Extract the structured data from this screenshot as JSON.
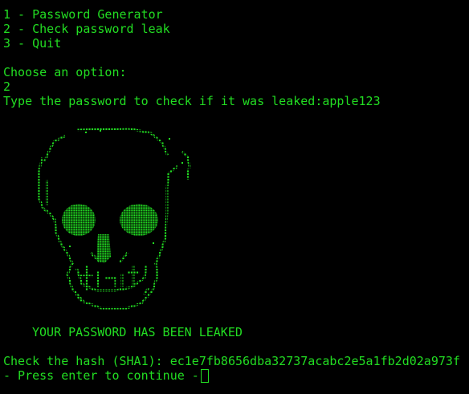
{
  "menu": {
    "items": [
      "1 - Password Generator",
      "2 - Check password leak",
      "3 - Quit"
    ]
  },
  "prompt": {
    "choose": "Choose an option:",
    "choice": "2",
    "check_prompt": "Type the password to check if it was leaked:apple123"
  },
  "skull": {
    "icon": "skull-icon",
    "color": "#22dd22"
  },
  "result": {
    "leaked_message": "YOUR PASSWORD HAS BEEN LEAKED",
    "hash_line": "Check the hash (SHA1): ec1e7fb8656dba32737acabc2e5a1fb2d02a973f",
    "continue_prompt": "- Press enter to continue -"
  },
  "colors": {
    "background": "#000000",
    "text": "#22dd22"
  }
}
